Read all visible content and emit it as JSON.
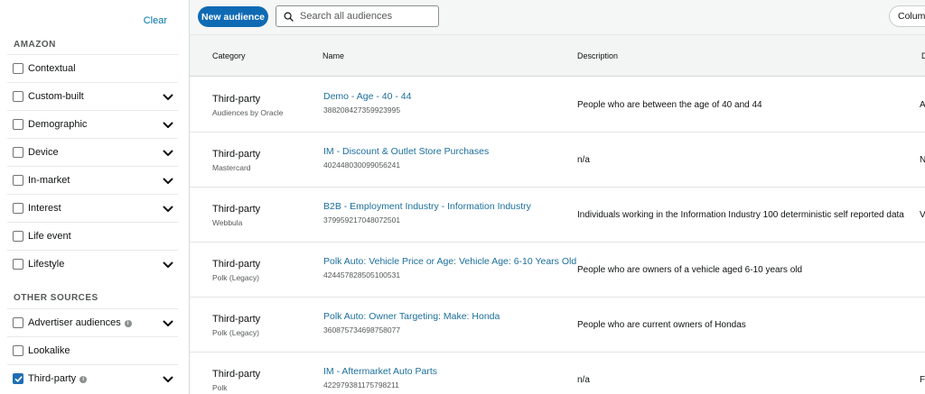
{
  "sidebar": {
    "clear_label": "Clear",
    "amazon_heading": "AMAZON",
    "other_heading": "OTHER SOURCES",
    "amazon_filters": [
      {
        "label": "Contextual",
        "checked": false,
        "expandable": false
      },
      {
        "label": "Custom-built",
        "checked": false,
        "expandable": true
      },
      {
        "label": "Demographic",
        "checked": false,
        "expandable": true
      },
      {
        "label": "Device",
        "checked": false,
        "expandable": true
      },
      {
        "label": "In-market",
        "checked": false,
        "expandable": true
      },
      {
        "label": "Interest",
        "checked": false,
        "expandable": true
      },
      {
        "label": "Life event",
        "checked": false,
        "expandable": false
      },
      {
        "label": "Lifestyle",
        "checked": false,
        "expandable": true
      }
    ],
    "other_filters": [
      {
        "label": "Advertiser audiences",
        "checked": false,
        "expandable": true,
        "info": true
      },
      {
        "label": "Lookalike",
        "checked": false,
        "expandable": false
      },
      {
        "label": "Third-party",
        "checked": true,
        "expandable": true,
        "info": true
      }
    ]
  },
  "toolbar": {
    "new_audience_label": "New audience",
    "search_placeholder": "Search all audiences",
    "columns_label": "Columns"
  },
  "table": {
    "headers": {
      "category": "Category",
      "name": "Name",
      "description": "Description",
      "edge": "D"
    },
    "rows": [
      {
        "category": "Third-party",
        "provider": "Audiences by Oracle",
        "name": "Demo - Age - 40 - 44",
        "id": "388208427359923995",
        "description": "People who are between the age of 40 and 44",
        "edge": "A"
      },
      {
        "category": "Third-party",
        "provider": "Mastercard",
        "name": "IM - Discount & Outlet Store Purchases",
        "id": "402448030099056241",
        "description": "n/a",
        "edge": "N"
      },
      {
        "category": "Third-party",
        "provider": "Webbula",
        "name": "B2B - Employment Industry - Information Industry",
        "id": "379959217048072501",
        "description": "Individuals working in the Information Industry 100 deterministic self reported data",
        "edge": "V"
      },
      {
        "category": "Third-party",
        "provider": "Polk (Legacy)",
        "name": "Polk Auto: Vehicle Price or Age: Vehicle Age: 6-10 Years Old",
        "id": "424457828505100531",
        "description": "People who are owners of a vehicle aged 6-10 years old",
        "edge": ""
      },
      {
        "category": "Third-party",
        "provider": "Polk (Legacy)",
        "name": "Polk Auto: Owner Targeting: Make: Honda",
        "id": "360875734698758077",
        "description": "People who are current owners of Hondas",
        "edge": ""
      },
      {
        "category": "Third-party",
        "provider": "Polk",
        "name": "IM - Aftermarket Auto Parts",
        "id": "422979381175798211",
        "description": "n/a",
        "edge": "F"
      }
    ]
  },
  "colors": {
    "accent": "#0f6ab4",
    "link": "#1b6f9c"
  }
}
